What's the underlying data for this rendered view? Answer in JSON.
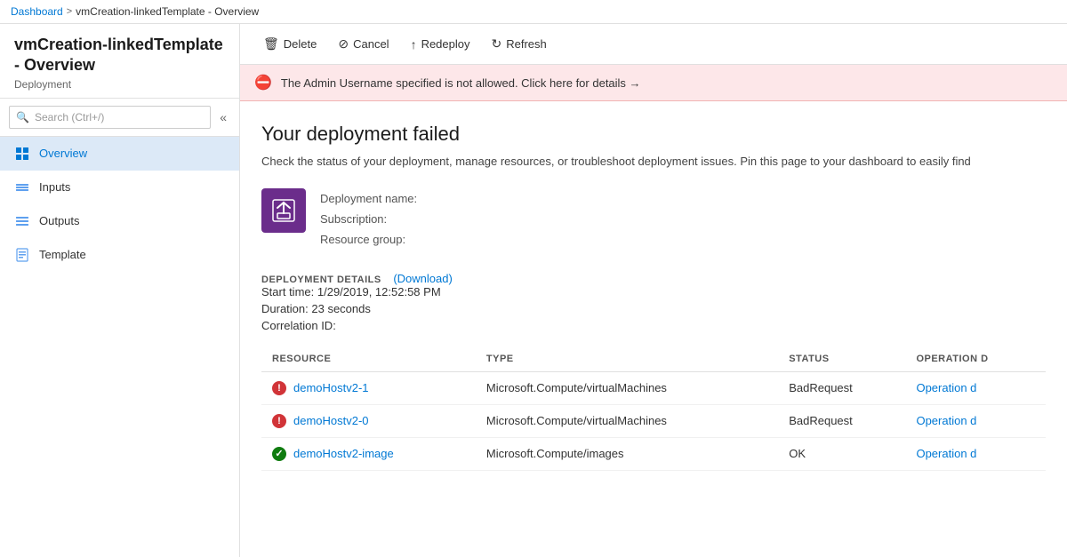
{
  "breadcrumb": {
    "home": "Dashboard",
    "separator1": ">",
    "separator2": ">",
    "current": "vmCreation-linkedTemplate - Overview"
  },
  "sidebar": {
    "page_title": "vmCreation-linkedTemplate - Overview",
    "page_subtitle": "Deployment",
    "search_placeholder": "Search (Ctrl+/)",
    "nav_items": [
      {
        "id": "overview",
        "label": "Overview",
        "icon": "overview",
        "active": true
      },
      {
        "id": "inputs",
        "label": "Inputs",
        "icon": "inputs",
        "active": false
      },
      {
        "id": "outputs",
        "label": "Outputs",
        "icon": "outputs",
        "active": false
      },
      {
        "id": "template",
        "label": "Template",
        "icon": "template",
        "active": false
      }
    ]
  },
  "toolbar": {
    "delete_label": "Delete",
    "cancel_label": "Cancel",
    "redeploy_label": "Redeploy",
    "refresh_label": "Refresh"
  },
  "alert": {
    "message": "The Admin Username specified is not allowed. Click here for details →"
  },
  "main": {
    "deployment_failed_title": "Your deployment failed",
    "deployment_desc": "Check the status of your deployment, manage resources, or troubleshoot deployment issues. Pin this page to your dashboard to easily find",
    "deployment_name_label": "Deployment name:",
    "subscription_label": "Subscription:",
    "resource_group_label": "Resource group:",
    "details_heading": "DEPLOYMENT DETAILS",
    "download_label": "(Download)",
    "start_time_label": "Start time:",
    "start_time_value": "1/29/2019, 12:52:58 PM",
    "duration_label": "Duration:",
    "duration_value": "23 seconds",
    "correlation_label": "Correlation ID:",
    "correlation_value": ""
  },
  "table": {
    "col_resource": "RESOURCE",
    "col_type": "TYPE",
    "col_status": "STATUS",
    "col_operation": "OPERATION D",
    "rows": [
      {
        "status_type": "error",
        "resource_name": "demoHostv2-1",
        "type": "Microsoft.Compute/virtualMachines",
        "status": "BadRequest",
        "operation": "Operation d"
      },
      {
        "status_type": "error",
        "resource_name": "demoHostv2-0",
        "type": "Microsoft.Compute/virtualMachines",
        "status": "BadRequest",
        "operation": "Operation d"
      },
      {
        "status_type": "success",
        "resource_name": "demoHostv2-image",
        "type": "Microsoft.Compute/images",
        "status": "OK",
        "operation": "Operation d"
      }
    ]
  }
}
